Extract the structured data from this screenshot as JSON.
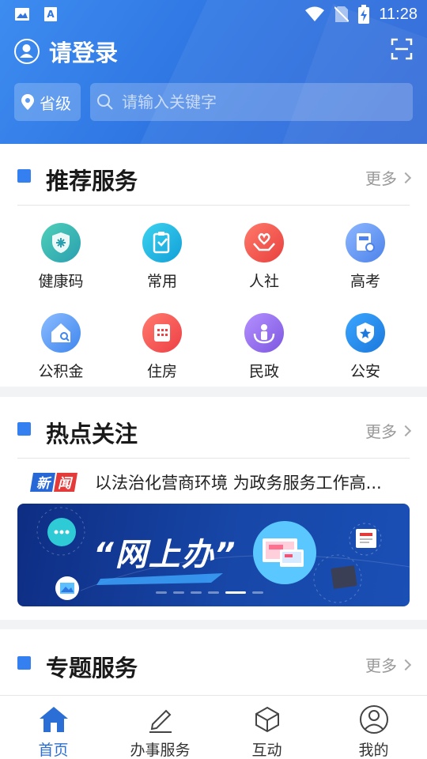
{
  "status_bar": {
    "time": "11:28",
    "left_icons": [
      "image-icon",
      "text-a-icon"
    ],
    "right_icons": [
      "wifi-icon",
      "no-sim-icon",
      "battery-charging-icon"
    ]
  },
  "header": {
    "login_label": "请登录",
    "location_label": "省级",
    "search_placeholder": "请输入关键字",
    "brand_color": "#2f76e3"
  },
  "recommended": {
    "title": "推荐服务",
    "more_label": "更多",
    "items": [
      {
        "label": "健康码",
        "icon": "health-code-icon",
        "color": "#3ab3a5"
      },
      {
        "label": "常用",
        "icon": "clipboard-icon",
        "color": "#1fb6e6"
      },
      {
        "label": "人社",
        "icon": "hands-heart-icon",
        "color": "#f0564e"
      },
      {
        "label": "高考",
        "icon": "exam-certificate-icon",
        "color": "#5a92f0"
      },
      {
        "label": "公积金",
        "icon": "house-fund-icon",
        "color": "#5a9af2"
      },
      {
        "label": "住房",
        "icon": "building-icon",
        "color": "#f24f4f"
      },
      {
        "label": "民政",
        "icon": "people-care-icon",
        "color": "#8b66e6"
      },
      {
        "label": "公安",
        "icon": "police-badge-icon",
        "color": "#2a8de8"
      }
    ]
  },
  "hot": {
    "title": "热点关注",
    "more_label": "更多",
    "news_badge": "新闻",
    "news_headline": "以法治化营商环境 为政务服务工作高...",
    "banner_title": "“网上办”",
    "carousel": {
      "count": 6,
      "active_index": 4
    }
  },
  "topics": {
    "title": "专题服务",
    "more_label": "更多"
  },
  "tabbar": {
    "active_color": "#2b6fd6",
    "items": [
      {
        "label": "首页",
        "icon": "home-icon",
        "active": true
      },
      {
        "label": "办事服务",
        "icon": "pen-icon",
        "active": false
      },
      {
        "label": "互动",
        "icon": "cube-icon",
        "active": false
      },
      {
        "label": "我的",
        "icon": "user-icon",
        "active": false
      }
    ]
  }
}
